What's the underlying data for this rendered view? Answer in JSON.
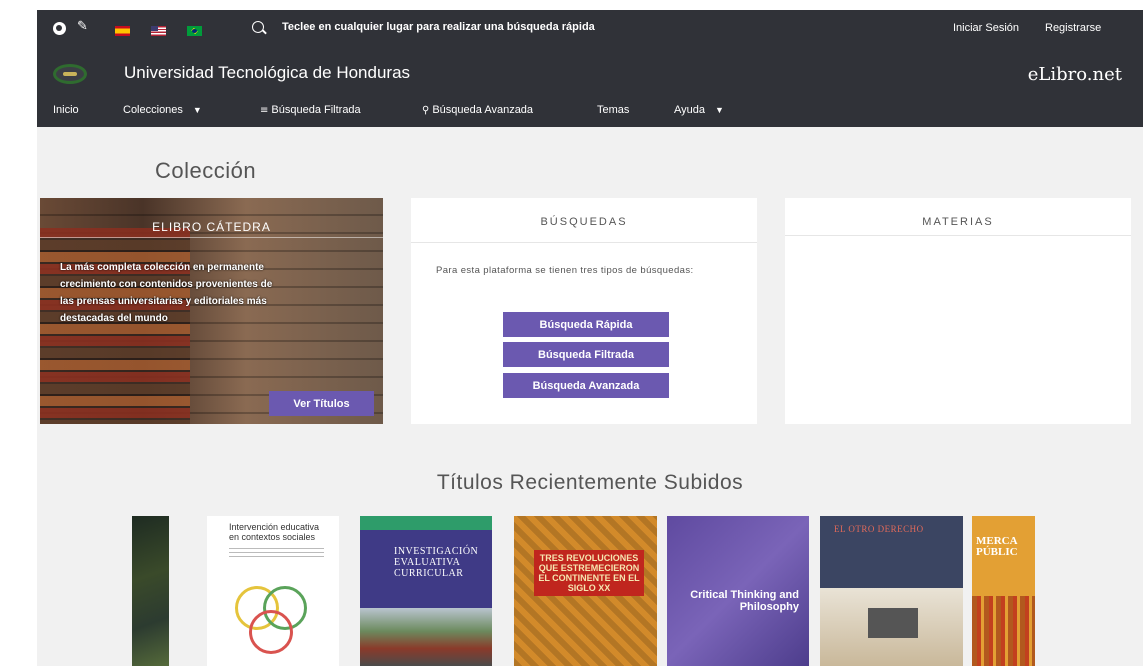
{
  "header": {
    "search_text": "Teclee en cualquier lugar para realizar una búsqueda rápida",
    "login": "Iniciar Sesión",
    "register": "Registrarse",
    "university": "Universidad Tecnológica de Honduras",
    "brand": "eLibro.net",
    "icons": [
      "globe-icon",
      "wrench-icon",
      "flag-es",
      "flag-us",
      "flag-br",
      "search-icon"
    ]
  },
  "nav": {
    "home": "Inicio",
    "collections": "Colecciones",
    "filtered": "Búsqueda Filtrada",
    "advanced": "Búsqueda Avanzada",
    "topics": "Temas",
    "help": "Ayuda"
  },
  "collection": {
    "heading": "Colección",
    "catedra": {
      "title": "ELIBRO CÁTEDRA",
      "text": "La más completa colección en permanente crecimiento con contenidos provenientes de las prensas universitarias y editoriales más destacadas del mundo",
      "button": "Ver Títulos"
    },
    "searches": {
      "title": "BÚSQUEDAS",
      "text": "Para esta plataforma se tienen tres tipos de búsquedas:",
      "buttons": [
        "Búsqueda Rápida",
        "Búsqueda Filtrada",
        "Búsqueda Avanzada"
      ]
    },
    "subjects": {
      "title": "MATERIAS"
    }
  },
  "recent": {
    "heading": "Títulos Recientemente Subidos",
    "covers": [
      {
        "title": ""
      },
      {
        "title": "Intervención educativa en contextos sociales"
      },
      {
        "title": "INVESTIGACIÓN EVALUATIVA CURRICULAR"
      },
      {
        "title": "TRES REVOLUCIONES QUE ESTREMECIERON EL CONTINENTE EN EL SIGLO XX"
      },
      {
        "title": "Critical Thinking and Philosophy"
      },
      {
        "title": "EL OTRO DERECHO"
      },
      {
        "title": "MERCA PÚBLIC"
      }
    ]
  },
  "colors": {
    "header_bg": "#303238",
    "accent": "#6b59b0",
    "page_bg": "#f1f1f1"
  }
}
